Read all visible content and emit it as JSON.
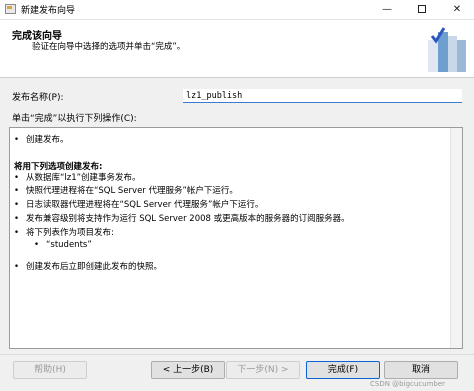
{
  "window": {
    "title": "新建发布向导"
  },
  "header": {
    "title": "完成该向导",
    "subtitle": "验证在向导中选择的选项并单击“完成”。"
  },
  "form": {
    "name_label": "发布名称(P):",
    "name_value": "lz1_publish",
    "actions_label": "单击“完成”以执行下列操作(C):"
  },
  "actions": {
    "first": "创建发布。",
    "heading": "将用下列选项创建发布:",
    "items": [
      "从数据库“lz1”创建事务发布。",
      "快照代理进程将在“SQL Server 代理服务”帐户下运行。",
      "日志读取器代理进程将在“SQL Server 代理服务”帐户下运行。",
      "发布兼容级别将支持作为运行 SQL Server 2008 或更高版本的服务器的订阅服务器。",
      "将下列表作为项目发布:"
    ],
    "sub_item": "“students”",
    "last": "创建发布后立即创建此发布的快照。"
  },
  "buttons": {
    "help": "帮助(H)",
    "back": "< 上一步(B)",
    "next": "下一步(N) >",
    "finish": "完成(F)",
    "cancel": "取消"
  },
  "watermark": "CSDN @bigcucumber"
}
